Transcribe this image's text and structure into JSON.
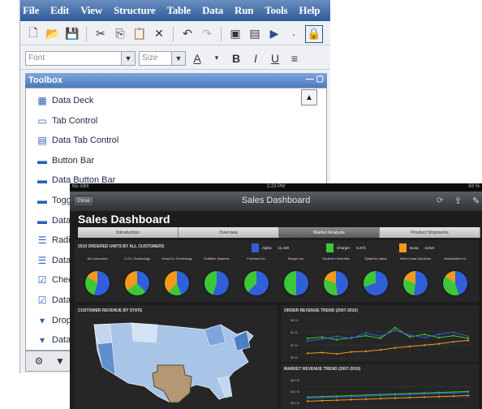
{
  "ide": {
    "menu": [
      "File",
      "Edit",
      "View",
      "Structure",
      "Table",
      "Data",
      "Run",
      "Tools",
      "Help"
    ],
    "font_placeholder": "Font",
    "size_placeholder": "Size",
    "toolbox_title": "Toolbox",
    "toolbox_items": [
      {
        "label": "Data Deck",
        "icon": "data-deck-icon"
      },
      {
        "label": "Tab Control",
        "icon": "tab-control-icon"
      },
      {
        "label": "Data Tab Control",
        "icon": "data-tab-control-icon"
      },
      {
        "label": "Button Bar",
        "icon": "button-bar-icon"
      },
      {
        "label": "Data Button Bar",
        "icon": "data-button-bar-icon"
      },
      {
        "label": "Togg",
        "icon": "toggle-icon"
      },
      {
        "label": "Data",
        "icon": "data-icon"
      },
      {
        "label": "Radi",
        "icon": "radio-icon"
      },
      {
        "label": "Data",
        "icon": "data-radio-icon"
      },
      {
        "label": "Chec",
        "icon": "checkbox-icon"
      },
      {
        "label": "Data",
        "icon": "data-checkbox-icon"
      },
      {
        "label": "Drop",
        "icon": "dropdown-icon"
      },
      {
        "label": "Data",
        "icon": "data-dropdown-icon"
      }
    ]
  },
  "ipad": {
    "status_left": "No SIM",
    "status_time": "2:23 PM",
    "status_right": "63 %",
    "close_label": "Close",
    "nav_title": "Sales Dashboard",
    "dashboard_title": "Sales Dashboard",
    "tabs": [
      {
        "label": "Introduction",
        "active": false
      },
      {
        "label": "Overview",
        "active": false
      },
      {
        "label": "Market Analysis",
        "active": true
      },
      {
        "label": "Product Shipments",
        "active": false
      }
    ],
    "units_title": "2010 ORDERED UNITS BY ALL CUSTOMERS",
    "legend": [
      {
        "name": "Alpha",
        "value": "11,428",
        "color": "#2f5fd9"
      },
      {
        "name": "Charger",
        "value": "6,373",
        "color": "#3ec63a"
      },
      {
        "name": "Nova",
        "value": "3,619",
        "color": "#f39a1c"
      }
    ],
    "customers": [
      "All Customers",
      "C.O.L Technology",
      "GreenCo Technology",
      "GulfMex Systems",
      "Freedom Inc.",
      "Ranger Inc.",
      "Southern Scientific",
      "Systems Latina",
      "West Coast Solutions",
      "Workstation Int."
    ],
    "map_title": "CUSTOMER REVENUE BY STATE",
    "order_title": "ORDER REVENUE TREND (2007-2010)",
    "market_title": "MARKET REVENUE TREND (2007-2010)",
    "order_ticks": [
      "$6 M",
      "$4 M",
      "$2 M",
      "$0 M"
    ],
    "market_ticks": [
      "$60 M",
      "$40 M",
      "$20 M"
    ]
  },
  "chart_data": [
    {
      "type": "pie",
      "title": "2010 ORDERED UNITS BY ALL CUSTOMERS",
      "categories": [
        "Alpha",
        "Charger",
        "Nova"
      ],
      "pies": [
        {
          "label": "All Customers",
          "values": [
            54,
            30,
            16
          ]
        },
        {
          "label": "C.O.L Technology",
          "values": [
            38,
            27,
            35
          ]
        },
        {
          "label": "GreenCo Technology",
          "values": [
            44,
            18,
            38
          ]
        },
        {
          "label": "GulfMex Systems",
          "values": [
            55,
            45,
            0
          ]
        },
        {
          "label": "Freedom Inc.",
          "values": [
            62,
            38,
            0
          ]
        },
        {
          "label": "Ranger Inc.",
          "values": [
            50,
            50,
            0
          ]
        },
        {
          "label": "Southern Scientific",
          "values": [
            48,
            32,
            20
          ]
        },
        {
          "label": "Systems Latina",
          "values": [
            70,
            30,
            0
          ]
        },
        {
          "label": "West Coast Solutions",
          "values": [
            52,
            28,
            20
          ]
        },
        {
          "label": "Workstation Int.",
          "values": [
            45,
            40,
            15
          ]
        }
      ]
    },
    {
      "type": "line",
      "title": "ORDER REVENUE TREND (2007-2010)",
      "ylim": [
        0,
        6
      ],
      "series": [
        {
          "color": "#3ec63a",
          "values": [
            3.0,
            3.2,
            2.8,
            3.1,
            3.4,
            3.0,
            4.6,
            3.2,
            3.6,
            3.1,
            3.4,
            3.0
          ]
        },
        {
          "color": "#2f5fd9",
          "values": [
            2.6,
            2.9,
            3.3,
            3.0,
            3.8,
            3.3,
            4.2,
            3.5,
            3.1,
            3.6,
            3.9,
            3.3
          ]
        },
        {
          "color": "#f39a1c",
          "values": [
            0.8,
            0.9,
            0.7,
            1.0,
            1.1,
            1.3,
            1.6,
            1.8,
            2.0,
            2.2,
            2.5,
            2.7
          ]
        }
      ]
    },
    {
      "type": "line",
      "title": "MARKET REVENUE TREND (2007-2010)",
      "ylim": [
        0,
        60
      ],
      "series": [
        {
          "color": "#3ec63a",
          "values": [
            20,
            21,
            22,
            23,
            24,
            25,
            26,
            27,
            28,
            29,
            30,
            31
          ]
        },
        {
          "color": "#2f5fd9",
          "values": [
            18,
            19,
            20,
            21,
            22,
            23,
            24,
            25,
            26,
            27,
            28,
            29
          ]
        },
        {
          "color": "#f39a1c",
          "values": [
            12,
            13,
            14,
            15,
            16,
            17,
            18,
            19,
            20,
            21,
            22,
            23
          ]
        }
      ]
    }
  ]
}
